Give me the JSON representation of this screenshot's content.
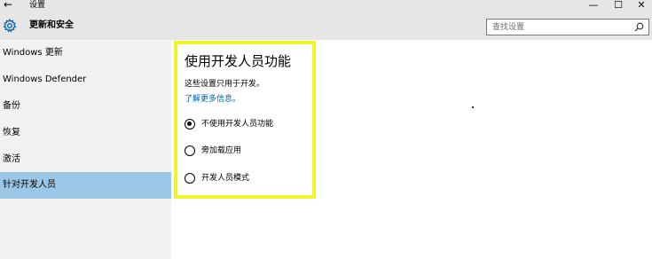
{
  "window": {
    "title": "设置",
    "back_glyph": "←",
    "minimize_glyph": "—",
    "maximize_glyph": "☐",
    "close_glyph": "✕"
  },
  "header": {
    "section_title": "更新和安全",
    "search_placeholder": "查找设置"
  },
  "sidebar": {
    "items": [
      {
        "label": "Windows 更新",
        "selected": false
      },
      {
        "label": "Windows Defender",
        "selected": false
      },
      {
        "label": "备份",
        "selected": false
      },
      {
        "label": "恢复",
        "selected": false
      },
      {
        "label": "激活",
        "selected": false
      },
      {
        "label": "针对开发人员",
        "selected": true
      }
    ]
  },
  "content": {
    "title": "使用开发人员功能",
    "description": "这些设置只用于开发。",
    "learn_more": "了解更多信息。",
    "options": [
      {
        "label": "不使用开发人员功能",
        "checked": true
      },
      {
        "label": "旁加载应用",
        "checked": false
      },
      {
        "label": "开发人员模式",
        "checked": false
      }
    ]
  },
  "colors": {
    "selected_nav": "#9cc6e6",
    "highlight_border": "#f3f32a",
    "link": "#0063b1",
    "accent_icon": "#0063b1"
  },
  "icons": {
    "header": "gear-icon",
    "search": "search-icon",
    "back": "back-arrow-icon"
  }
}
